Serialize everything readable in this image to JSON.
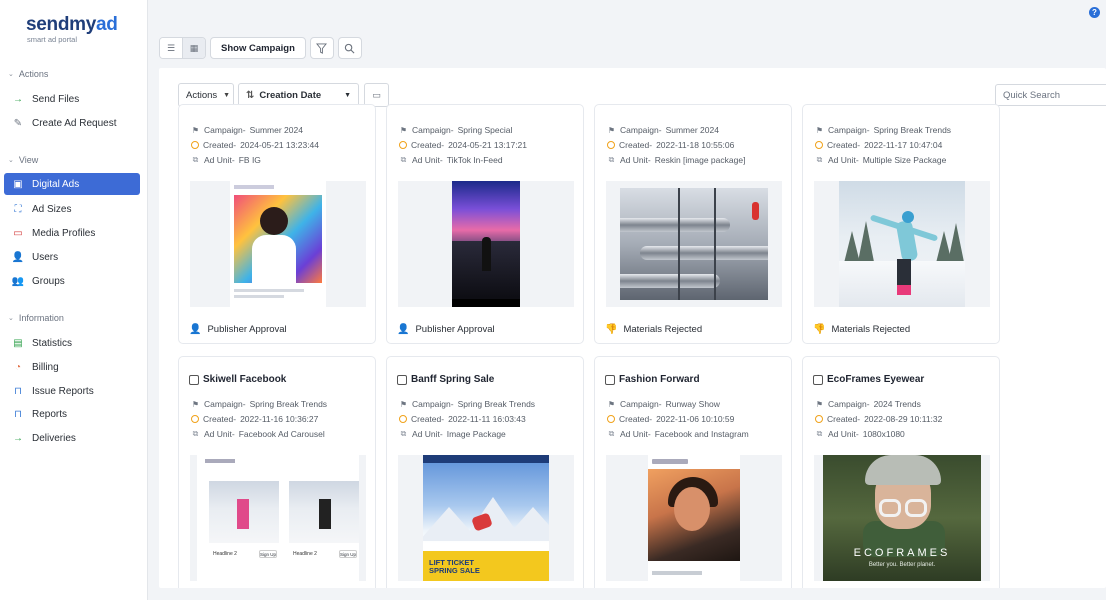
{
  "app": {
    "logo_main": "sendmy",
    "logo_accent": "ad",
    "logo_sub": "smart ad portal"
  },
  "sidebar": {
    "sections": [
      {
        "title": "Actions",
        "items": [
          {
            "label": "Send Files",
            "icon": "arrow-right-icon"
          },
          {
            "label": "Create Ad Request",
            "icon": "edit-icon"
          }
        ]
      },
      {
        "title": "View",
        "items": [
          {
            "label": "Digital Ads",
            "icon": "ad-icon",
            "active": true
          },
          {
            "label": "Ad Sizes",
            "icon": "resize-icon"
          },
          {
            "label": "Media Profiles",
            "icon": "monitor-icon"
          },
          {
            "label": "Users",
            "icon": "user-icon"
          },
          {
            "label": "Groups",
            "icon": "group-icon"
          }
        ]
      },
      {
        "title": "Information",
        "items": [
          {
            "label": "Statistics",
            "icon": "chart-icon"
          },
          {
            "label": "Billing",
            "icon": "billing-icon"
          },
          {
            "label": "Issue Reports",
            "icon": "bookmark-icon"
          },
          {
            "label": "Reports",
            "icon": "bookmark-icon"
          },
          {
            "label": "Deliveries",
            "icon": "arrow-right-icon"
          }
        ]
      }
    ]
  },
  "toolbar": {
    "show_campaign": "Show Campaign"
  },
  "panel": {
    "actions_label": "Actions",
    "sort_label": "Creation Date",
    "search_placeholder": "Quick Search"
  },
  "labels": {
    "campaign": "Campaign-",
    "created": "Created-",
    "ad_unit": "Ad Unit-"
  },
  "cards_top": [
    {
      "campaign": "Summer 2024",
      "created": "2024-05-21 13:23:44",
      "ad_unit": "FB IG",
      "status": "Publisher Approval",
      "status_type": "approved"
    },
    {
      "campaign": "Spring Special",
      "created": "2024-05-21 13:17:21",
      "ad_unit": "TikTok In-Feed",
      "status": "Publisher Approval",
      "status_type": "approved"
    },
    {
      "campaign": "Summer 2024",
      "created": "2022-11-18 10:55:06",
      "ad_unit": "Reskin [image package]",
      "status": "Materials Rejected",
      "status_type": "rejected"
    },
    {
      "campaign": "Spring Break Trends",
      "created": "2022-11-17 10:47:04",
      "ad_unit": "Multiple Size Package",
      "status": "Materials Rejected",
      "status_type": "rejected"
    }
  ],
  "cards_bottom": [
    {
      "title": "Skiwell Facebook",
      "campaign": "Spring Break Trends",
      "created": "2022-11-16 10:36:27",
      "ad_unit": "Facebook Ad Carousel"
    },
    {
      "title": "Banff Spring Sale",
      "campaign": "Spring Break Trends",
      "created": "2022-11-11 16:03:43",
      "ad_unit": "Image Package"
    },
    {
      "title": "Fashion Forward",
      "campaign": "Runway Show",
      "created": "2022-11-06 10:10:59",
      "ad_unit": "Facebook and Instagram"
    },
    {
      "title": "EcoFrames Eyewear",
      "campaign": "2024 Trends",
      "created": "2022-08-29 10:11:32",
      "ad_unit": "1080x1080"
    }
  ],
  "artwork": {
    "banff_text_1": "LIFT TICKET",
    "banff_text_2": "SPRING SALE",
    "eco_brand": "ECOFRAMES",
    "eco_tag": "Better you. Better planet.",
    "skiwell_cap_1": "Headline 2",
    "skiwell_cap_2": "Headline 2",
    "skiwell_btn": "Sign Up"
  },
  "colors": {
    "accent": "#3d6bd6",
    "brand": "#1f3e7a",
    "rejected": "#d33c3c",
    "pending": "#f0a21a"
  }
}
